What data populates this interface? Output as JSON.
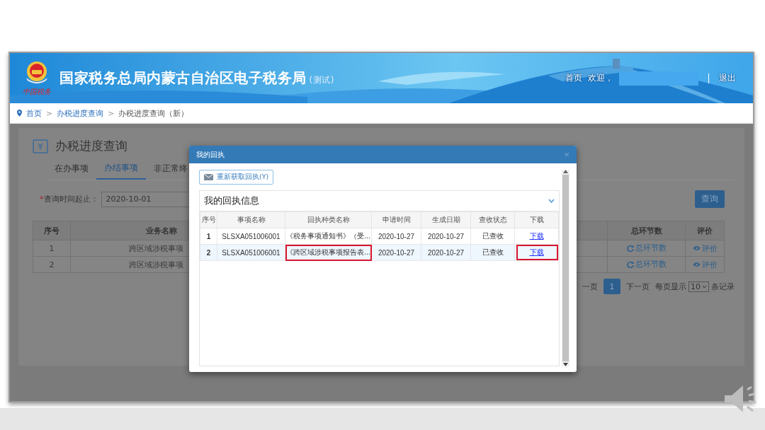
{
  "header": {
    "logo_caption": "中国税务",
    "site_title": "国家税务总局内蒙古自治区电子税务局",
    "site_badge": "(测试)",
    "nav": [
      {
        "label": "首页"
      },
      {
        "label": "欢迎，"
      }
    ],
    "logout": "退出"
  },
  "breadcrumb": {
    "separator": ">",
    "items": [
      {
        "label": "首页",
        "link": true
      },
      {
        "label": "办税进度查询",
        "link": true
      },
      {
        "label": "办税进度查询（新）",
        "link": false
      }
    ]
  },
  "page": {
    "title": "办税进度查询",
    "tabs": [
      {
        "label": "在办事项",
        "selected": false
      },
      {
        "label": "办结事项",
        "selected": true
      },
      {
        "label": "非正常终",
        "selected": false
      }
    ],
    "query": {
      "label": "查询时间起止：",
      "required_mark": "*",
      "start_value": "2020-10-01",
      "button": "查询"
    },
    "table": {
      "columns": [
        "序号",
        "业务名称",
        "",
        "总环节数",
        "评价"
      ],
      "rows": [
        {
          "index": "1",
          "business": "跨区域涉税事项",
          "steps": "总环节数",
          "rate": "评价"
        },
        {
          "index": "2",
          "business": "跨区域涉税事项",
          "steps": "总环节数",
          "rate": "评价"
        }
      ]
    },
    "pagination": {
      "prev": "一页",
      "pages": [
        {
          "label": "1",
          "selected": true
        }
      ],
      "next": "下一页",
      "per_page_label": "每页显示",
      "per_page_value": "10",
      "suffix": "条记录"
    }
  },
  "dialog": {
    "title": "我的回执",
    "close": "×",
    "refresh_button": "重新获取回执(Y)",
    "panel_title": "我的回执信息",
    "columns": [
      "序号",
      "事项名称",
      "回执种类名称",
      "申请时间",
      "生成日期",
      "查收状态",
      "下载"
    ],
    "rows": [
      {
        "index": "1",
        "item": "SLSXA051006001",
        "kind_name": "《税务事项通知书》（受...",
        "applied": "2020-10-27",
        "generated": "2020-10-27",
        "status": "已查收",
        "download": "下载",
        "selected": false,
        "marked": false
      },
      {
        "index": "2",
        "item": "SLSXA051006001",
        "kind_name": "《跨区域涉税事项报告表...",
        "applied": "2020-10-27",
        "generated": "2020-10-27",
        "status": "已查收",
        "download": "下载",
        "selected": true,
        "marked": true
      }
    ]
  }
}
